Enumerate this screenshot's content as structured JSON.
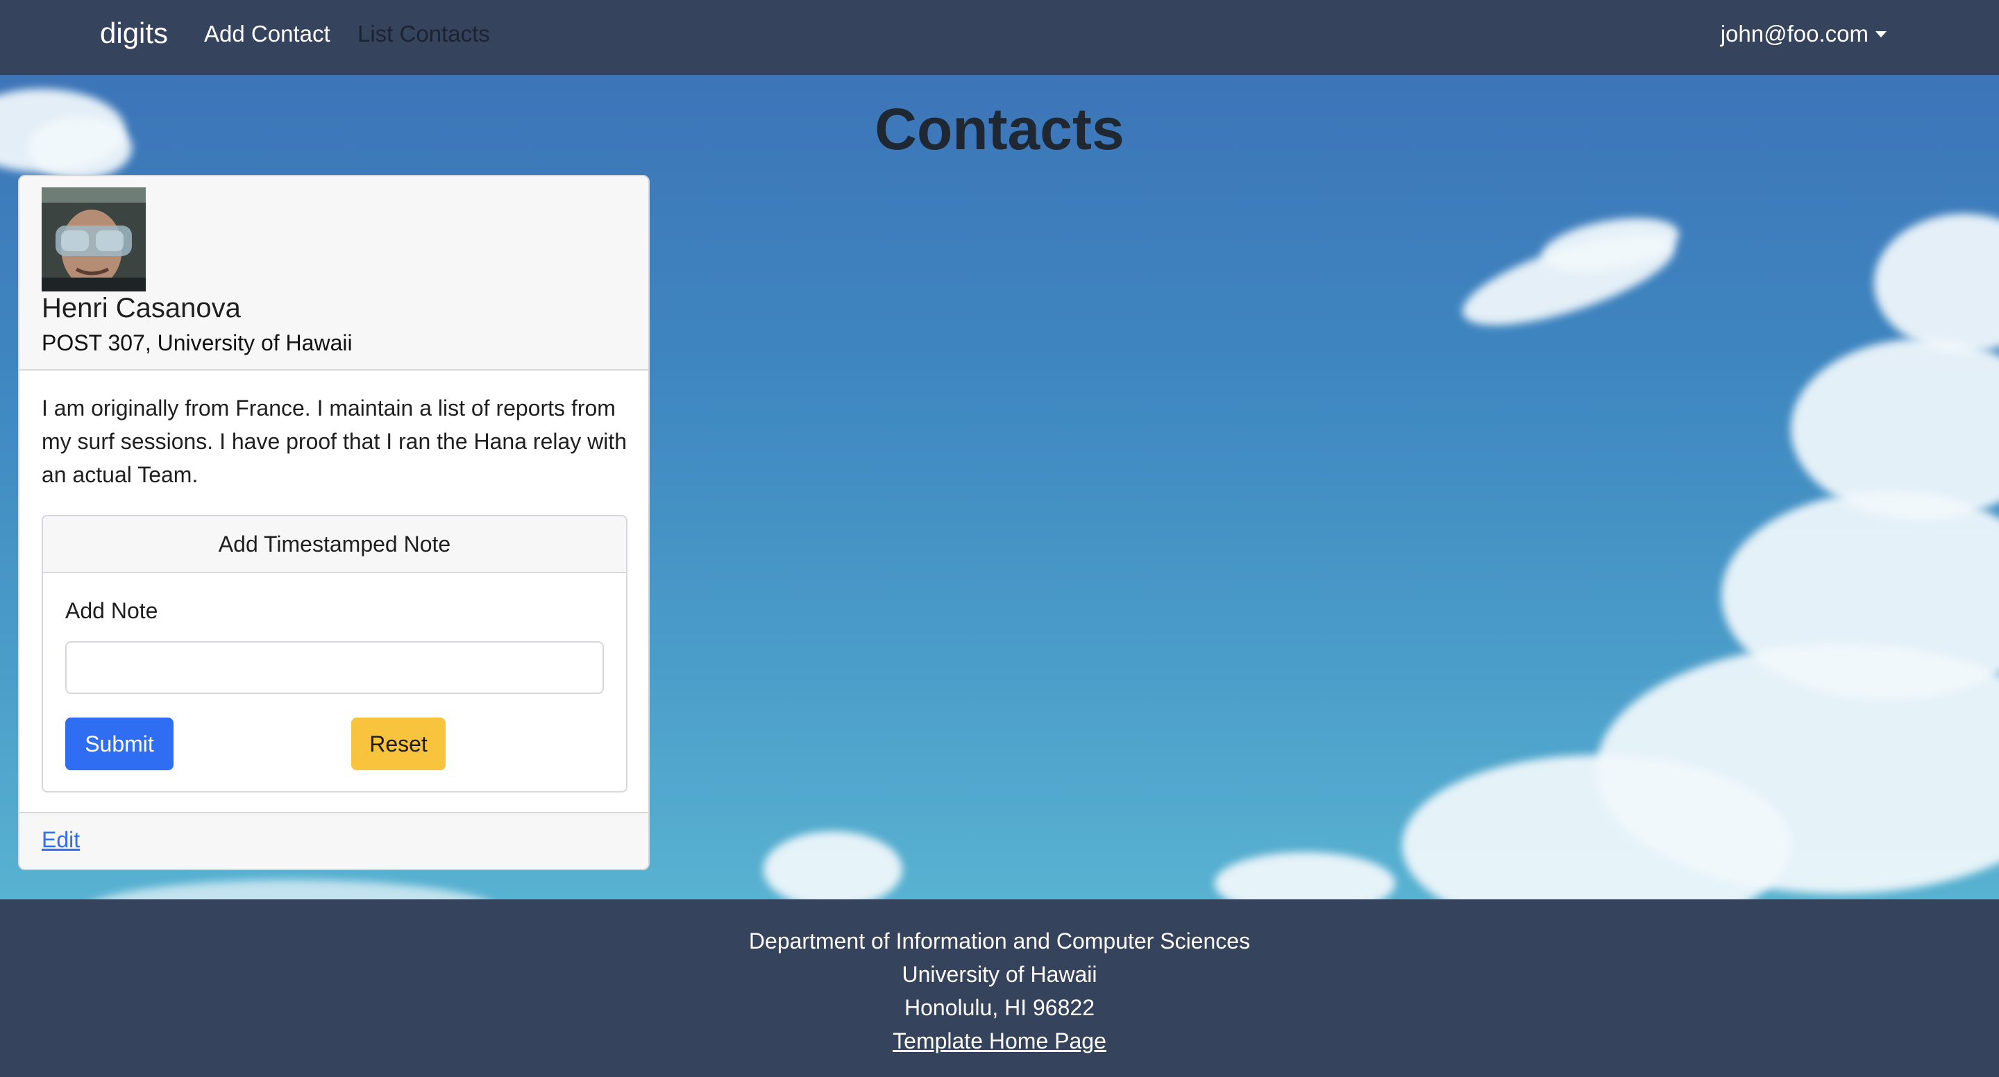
{
  "navbar": {
    "brand": "digits",
    "add_contact": "Add Contact",
    "list_contacts": "List Contacts",
    "user": "john@foo.com"
  },
  "page": {
    "title": "Contacts"
  },
  "contact": {
    "name": "Henri Casanova",
    "address": "POST 307, University of Hawaii",
    "description": "I am originally from France. I maintain a list of reports from my surf sessions. I have proof that I ran the Hana relay with an actual Team.",
    "edit_label": "Edit"
  },
  "note_form": {
    "header": "Add Timestamped Note",
    "label": "Add Note",
    "value": "",
    "submit_label": "Submit",
    "reset_label": "Reset"
  },
  "footer": {
    "line1": "Department of Information and Computer Sciences",
    "line2": "University of Hawaii",
    "line3": "Honolulu, HI 96822",
    "link": "Template Home Page"
  },
  "colors": {
    "navbar_bg": "#36435c",
    "primary_button": "#2f6ef2",
    "warning_button": "#f8c43e",
    "sky": "#3e86c0"
  }
}
